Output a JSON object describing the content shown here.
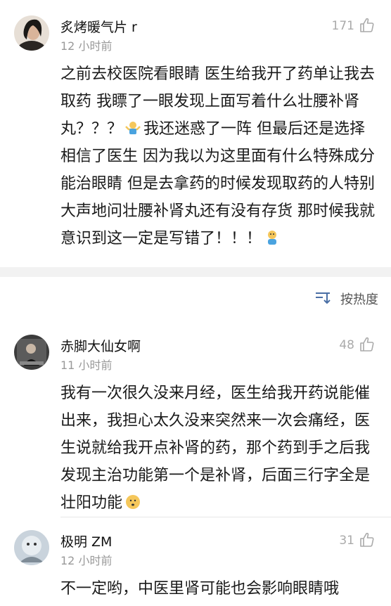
{
  "posts": [
    {
      "username": "炙烤暖气片 r",
      "time": "12 小时前",
      "likes": "171",
      "text_a": "之前去校医院看眼睛 医生给我开了药单让我去取药 我瞟了一眼发现上面写着什么壮腰补肾丸？？？",
      "text_b": "我还迷惑了一阵 但最后还是选择相信了医生 因为我以为这里面有什么特殊成分能治眼睛 但是去拿药的时候发现取药的人特别大声地问壮腰补肾丸还有没有存货 那时候我就意识到这一定是写错了！！！"
    }
  ],
  "sort": {
    "label": "按热度",
    "icon": "sort-icon"
  },
  "comments": [
    {
      "username": "赤脚大仙女啊",
      "time": "11 小时前",
      "likes": "48",
      "text": "我有一次很久没来月经，医生给我开药说能催出来，我担心太久没来突然来一次会痛经，医生说就给我开点补肾的药，那个药到手之后我发现主治功能第一个是补肾，后面三行字全是壮阳功能"
    },
    {
      "username": "极明 ZM",
      "time": "12 小时前",
      "likes": "31",
      "text": "不一定哟，中医里肾可能也会影响眼睛哦"
    }
  ],
  "colors": {
    "accent": "#4a6fa5",
    "muted": "#999999",
    "separator": "#f2f2f2"
  }
}
